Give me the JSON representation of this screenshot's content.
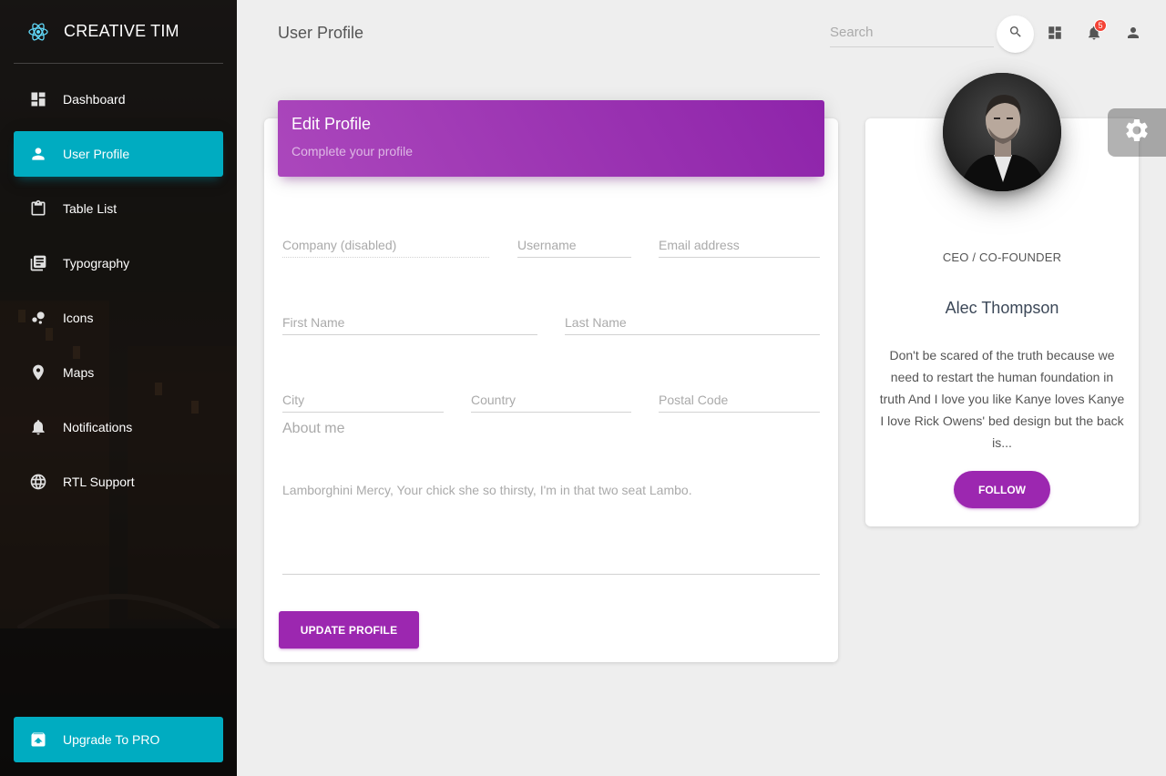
{
  "brand": {
    "name": "CREATIVE TIM",
    "logo_icon": "react-atom-icon",
    "accent": "#00acc1"
  },
  "sidebar": {
    "items": [
      {
        "label": "Dashboard",
        "icon": "dashboard-icon",
        "active": false
      },
      {
        "label": "User Profile",
        "icon": "person-icon",
        "active": true
      },
      {
        "label": "Table List",
        "icon": "clipboard-icon",
        "active": false
      },
      {
        "label": "Typography",
        "icon": "library-books-icon",
        "active": false
      },
      {
        "label": "Icons",
        "icon": "bubble-chart-icon",
        "active": false
      },
      {
        "label": "Maps",
        "icon": "location-pin-icon",
        "active": false
      },
      {
        "label": "Notifications",
        "icon": "bell-icon",
        "active": false
      },
      {
        "label": "RTL Support",
        "icon": "globe-icon",
        "active": false
      }
    ],
    "upgrade": {
      "label": "Upgrade To PRO",
      "icon": "unarchive-icon"
    }
  },
  "topbar": {
    "title": "User Profile",
    "search_placeholder": "Search",
    "notification_count": "5"
  },
  "edit_profile": {
    "title": "Edit Profile",
    "subtitle": "Complete your profile",
    "header_color": "#9c27b0",
    "fields": {
      "company": "Company (disabled)",
      "username": "Username",
      "email": "Email address",
      "first_name": "First Name",
      "last_name": "Last Name",
      "city": "City",
      "country": "Country",
      "postal_code": "Postal Code"
    },
    "about_label": "About me",
    "about_text": "Lamborghini Mercy, Your chick she so thirsty, I'm in that two seat Lambo.",
    "submit_label": "UPDATE PROFILE"
  },
  "profile_card": {
    "role": "CEO / CO-FOUNDER",
    "name": "Alec Thompson",
    "bio": "Don't be scared of the truth because we need to restart the human foundation in truth And I love you like Kanye loves Kanye I love Rick Owens' bed design but the back is...",
    "follow_label": "FOLLOW"
  },
  "settings": {
    "icon": "gear-icon"
  }
}
